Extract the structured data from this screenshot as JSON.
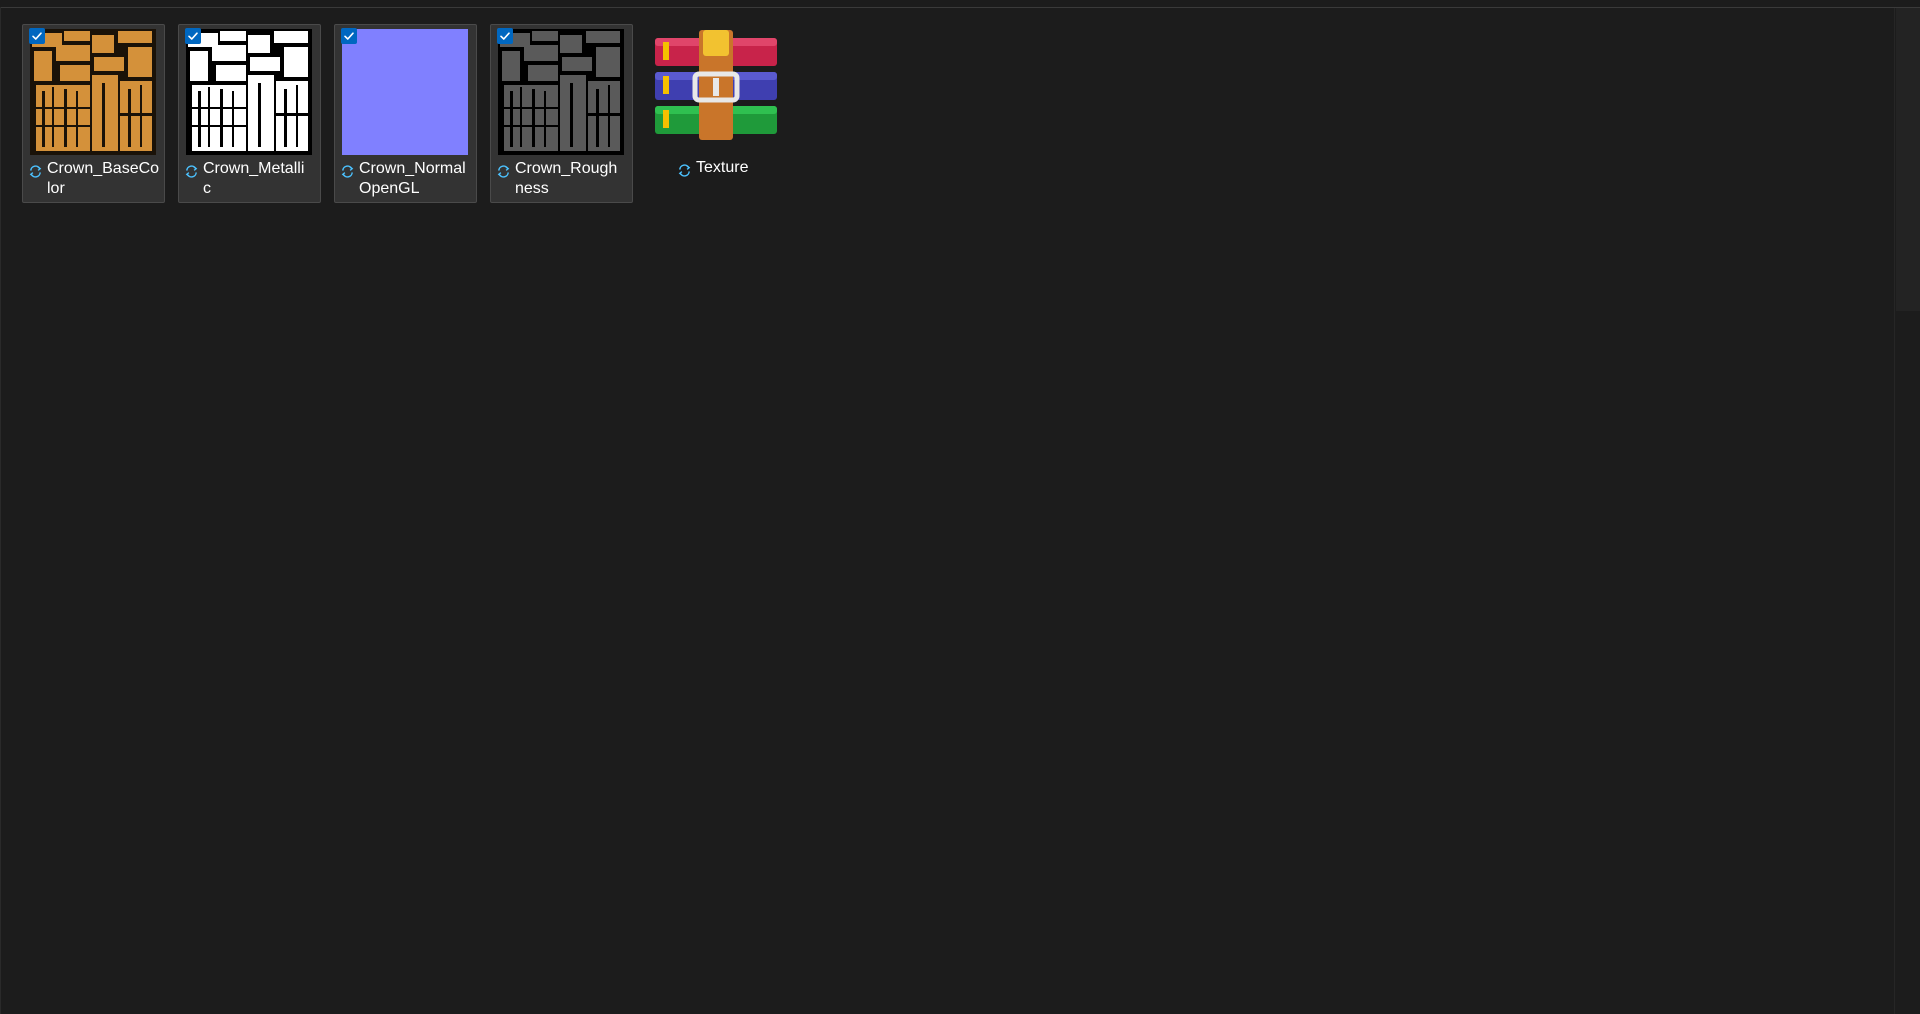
{
  "files": [
    {
      "name": "Crown_BaseColor",
      "line1": "Crown_BaseCo",
      "line2": "lor",
      "selected": true,
      "checked": true,
      "thumbnail": "orange-texture-map",
      "color": "#d4913a"
    },
    {
      "name": "Crown_Metallic",
      "line1": "Crown_Metalli",
      "line2": "c",
      "selected": true,
      "checked": true,
      "thumbnail": "white-on-black-mask",
      "color": "#ffffff"
    },
    {
      "name": "Crown_NormalOpenGL",
      "line1": "Crown_Normal",
      "line2": "OpenGL",
      "selected": true,
      "checked": true,
      "thumbnail": "flat-normal-map",
      "color": "#8080ff"
    },
    {
      "name": "Crown_Roughness",
      "line1": "Crown_Rough",
      "line2": "ness",
      "selected": true,
      "checked": true,
      "thumbnail": "gray-on-black-mask",
      "color": "#5a5a5a"
    },
    {
      "name": "Texture",
      "line1": "Texture",
      "line2": "",
      "selected": false,
      "checked": false,
      "thumbnail": "winrar-archive-icon"
    }
  ],
  "icons": {
    "checkbox": "checkmark-icon",
    "status": "sync-icon",
    "accent": "#0067c0",
    "sync_color": "#4cc2ff"
  }
}
